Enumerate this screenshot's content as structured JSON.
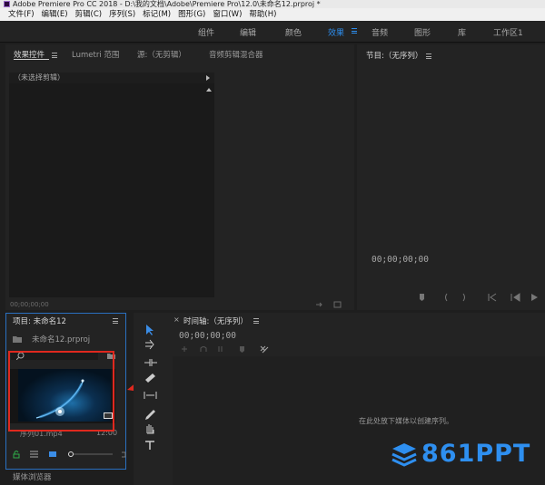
{
  "window": {
    "title": "Adobe Premiere Pro CC 2018 - D:\\我的文档\\Adobe\\Premiere Pro\\12.0\\未命名12.prproj *"
  },
  "menubar": {
    "items": [
      "文件(F)",
      "编辑(E)",
      "剪辑(C)",
      "序列(S)",
      "标记(M)",
      "图形(G)",
      "窗口(W)",
      "帮助(H)"
    ]
  },
  "workspaces": {
    "items": [
      "组件",
      "编辑",
      "颜色",
      "效果",
      "音频",
      "图形",
      "库",
      "工作区1"
    ],
    "active": "效果"
  },
  "source_panel": {
    "tabs": [
      "效果控件",
      "Lumetri 范围",
      "源:（无剪辑）",
      "音频剪辑混合器"
    ],
    "header": "（未选择剪辑）",
    "timecode": "00;00;00;00"
  },
  "program_panel": {
    "title": "节目:（无序列）",
    "timecode": "00;00;00;00",
    "controls": [
      "marker-icon",
      "mark-in-icon",
      "mark-out-icon",
      "go-to-in-icon",
      "step-back-icon",
      "play-icon"
    ]
  },
  "project_panel": {
    "title": "项目: 未命名12",
    "file": "未命名12.prproj",
    "clip_name": "序列01.mp4",
    "clip_duration": "12:00",
    "bottom_tab": "媒体浏览器"
  },
  "timeline_panel": {
    "title": "时间轴:（无序列）",
    "timecode": "00;00;00;00",
    "empty_hint": "在此处放下媒体以创建序列。"
  },
  "watermark": {
    "text": "861PPT"
  },
  "colors": {
    "accent": "#2d8ceb",
    "annotation_red": "#e0281e",
    "panel_bg": "#232323"
  }
}
